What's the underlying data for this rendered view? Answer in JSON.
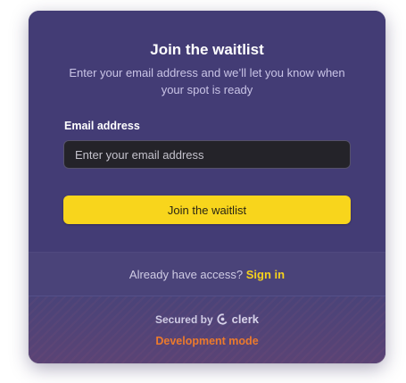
{
  "waitlist": {
    "title": "Join the waitlist",
    "subtitle": "Enter your email address and we’ll let you know when your spot is ready",
    "email_label": "Email address",
    "email_placeholder": "Enter your email address",
    "email_value": "",
    "submit_label": "Join the waitlist"
  },
  "access": {
    "question": "Already have access?",
    "sign_in_label": "Sign in"
  },
  "footer": {
    "secured_by": "Secured by",
    "brand": "clerk",
    "brand_icon": "clerk-logo-icon",
    "dev_mode": "Development mode"
  },
  "colors": {
    "card_bg": "#433c75",
    "accent": "#f8d51c",
    "link": "#f6d21c",
    "dev_mode": "#ec7a2c",
    "input_bg": "#242329"
  }
}
